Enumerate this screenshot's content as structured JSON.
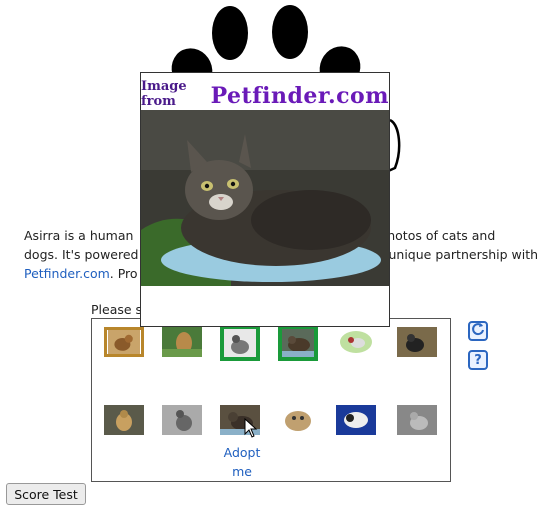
{
  "description": {
    "before": "Asirra is a human",
    "middle_hidden": " ",
    "line1_tail": "ntify photos of cats and",
    "line2_head": "dogs. It's powered",
    "line2_tail": "unique partnership with",
    "link": "Petfinder.com",
    "line3_tail": ". Pro"
  },
  "prompt": "Please s",
  "popup": {
    "header_small": "Image from",
    "header_big": "Petfinder.com"
  },
  "grid": {
    "adopt_label": "Adopt me"
  },
  "side_buttons": {
    "refresh_icon": "refresh-icon",
    "help_label": "?"
  },
  "score_button_label": "Score Test",
  "colors": {
    "link": "#1f5fbf",
    "selected_border": "#1a9a3a",
    "header_purple": "#6a1ab8",
    "button_blue": "#2b66c0"
  }
}
